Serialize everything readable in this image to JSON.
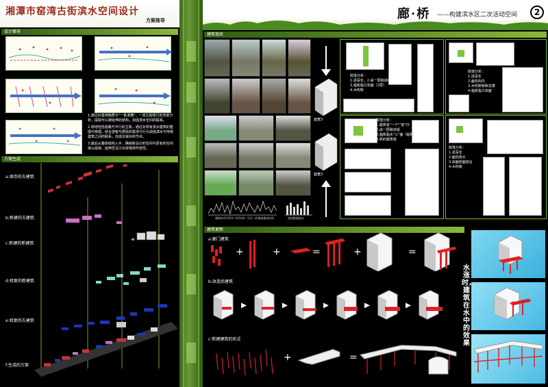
{
  "left": {
    "title": "湘潭市窑湾古街滨水空间设计",
    "subtitle": "方案推导",
    "section1": "设计推导",
    "section2": "方案生成",
    "note1": "1.通过对基地物质与\"一条滨横\"，一流主街现行的背景分析，提取可以被延伸的结构，加强滨水空间的联系。",
    "note2": "2.场地包括道路与平行的主街，通过对现有滨水建筑的整理与梳理，结合游客与居民的需求与行为加强滨水与传统建筑之间的联系，创造出良好的节点。",
    "note3": "3.最后从整体结构入手，确保新设计的空间与原有的空间得以延续，延伸至沿江水岸保持开放性。",
    "layers": [
      "a:保存的古建筑",
      "b:新建的古建筑",
      "c:新建的新建筑",
      "d:修复的新建筑",
      "e:修复的古建筑",
      "f:生成的方案"
    ]
  },
  "right": {
    "title": "廊·桥",
    "subtitle": "——构建滨水区二次活动空间",
    "number": "2",
    "section1": "建筑现状",
    "section2": "建筑更新",
    "chart1_label": "建筑年代1950~2010年（2月）的建筑建造时间",
    "chart2_label": "改造数量统计",
    "cross_label_top": "面宽3",
    "cross_label_bottom": "面宽3",
    "analysis1": [
      "院落分析：",
      "1.进深长，2.由一层跨进组",
      "3.临街临江双面（2层）",
      "4.木构架"
    ],
    "analysis2": [
      "院落分析：",
      "1.进深长",
      "2.面向向内",
      "3.木构架和砖支撑",
      "4.临街临江双面"
    ],
    "analysis3": [
      "院落分析：",
      "1.建筑有\"一个\"\"前\"厅",
      "2.由一层跨进组",
      "3.临街临水\"三\"面（临街）",
      "4.砖的建筑墙"
    ],
    "analysis4": [
      "院落分析：",
      "1.进深长",
      "2.面向高大",
      "3.由面前面前台",
      "4.木构架"
    ],
    "update_a": "a:廊门建筑",
    "update_b": "b:改造后建筑",
    "update_c": "c:新建建筑的形式",
    "vertical_text": "水涨时，建筑在水中的效果",
    "ops": [
      "+",
      "+",
      "=",
      "+",
      "="
    ]
  }
}
